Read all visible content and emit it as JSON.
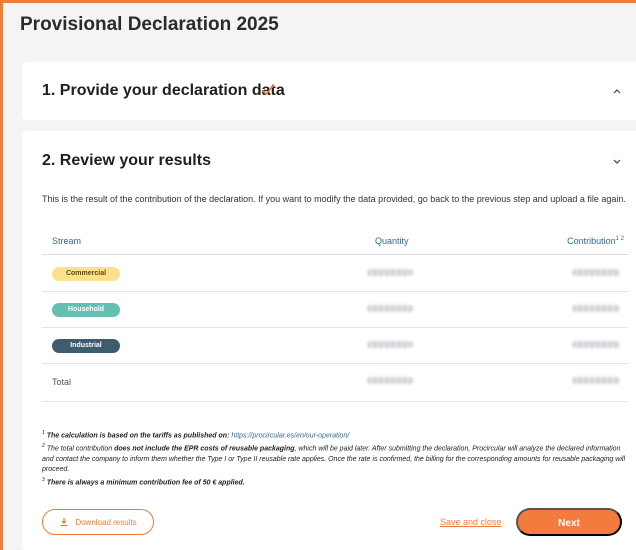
{
  "page": {
    "title": "Provisional Declaration 2025"
  },
  "step1": {
    "title": "1. Provide your declaration data"
  },
  "step2": {
    "title": "2. Review your results",
    "intro": "This is the result of the contribution of the declaration. If you want to modify the data provided, go back to the previous step and upload a file again."
  },
  "table": {
    "headers": {
      "stream": "Stream",
      "quantity": "Quantity",
      "contribution": "Contribution",
      "contribution_sup": "1 2"
    },
    "rows": [
      {
        "stream": "Commercial"
      },
      {
        "stream": "Household"
      },
      {
        "stream": "Industrial"
      }
    ],
    "total_label": "Total"
  },
  "notes": {
    "n1_prefix": "The calculation is based on the tariffs as published on: ",
    "n1_link": "https://procircular.es/en/our-operation/",
    "n2_a": "The total contribution ",
    "n2_bold": "does not include the EPR costs of reusable packaging",
    "n2_b": ", which will be paid later. After submitting the declaration, Procircular will analyze the declared information and contact the company to inform them whether the Type I or Type II reusable rate applies. Once the rate is confirmed, the billing for the corresponding amounts for reusable packaging will proceed.",
    "n3": "There is always a minimum contribution fee of 50 € applied."
  },
  "actions": {
    "download": "Download results",
    "save": "Save and close",
    "next": "Next"
  },
  "colors": {
    "accent": "#f07c3a",
    "commercial": "#fde08b",
    "household": "#63c0b3",
    "industrial": "#3e5c6c"
  }
}
